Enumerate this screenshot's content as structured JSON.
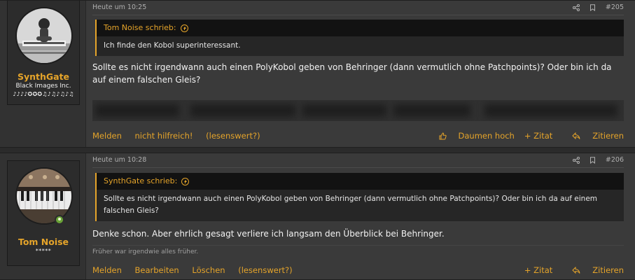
{
  "posts": [
    {
      "timestamp": "Heute um 10:25",
      "post_number": "#205",
      "user": {
        "name": "SynthGate",
        "title": "Black Images Inc.",
        "banner": "♪♪♪♪✪✪✪♫♪♫♪♫♪♫",
        "online": false
      },
      "quote": {
        "author": "Tom Noise schrieb:",
        "text": "Ich finde den Kobol superinteressant."
      },
      "message": "Sollte es nicht irgendwann auch einen PolyKobol geben von Behringer (dann vermutlich ohne Patchpoints)? Oder bin ich da auf einem falschen Gleis?",
      "actions_left": [
        "Melden",
        "nicht hilfreich!",
        "(lesenswert?)"
      ],
      "actions_right": [
        "Daumen hoch",
        "+ Zitat",
        "Zitieren"
      ]
    },
    {
      "timestamp": "Heute um 10:28",
      "post_number": "#206",
      "user": {
        "name": "Tom Noise",
        "title": "*****",
        "online": true
      },
      "quote": {
        "author": "SynthGate schrieb:",
        "text": "Sollte es nicht irgendwann auch einen PolyKobol geben von Behringer (dann vermutlich ohne Patchpoints)? Oder bin ich da auf einem falschen Gleis?"
      },
      "message": "Denke schon. Aber ehrlich gesagt verliere ich langsam den Überblick bei Behringer.",
      "signature": "Früher war irgendwie alles früher.",
      "actions_left": [
        "Melden",
        "Bearbeiten",
        "Löschen",
        "(lesenswert?)"
      ],
      "actions_right": [
        "+ Zitat",
        "Zitieren"
      ]
    }
  ],
  "colors": {
    "accent": "#e5a42a",
    "background": "#3a3a3a",
    "quote_header": "#121212",
    "online": "#6aa337"
  }
}
